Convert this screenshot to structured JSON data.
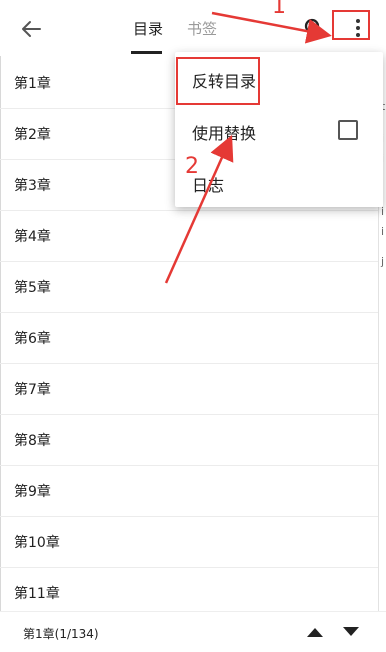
{
  "header": {
    "tabs": [
      "目录",
      "书签"
    ]
  },
  "chapters": [
    "第1章",
    "第2章",
    "第3章",
    "第4章",
    "第5章",
    "第6章",
    "第7章",
    "第8章",
    "第9章",
    "第10章",
    "第11章"
  ],
  "menu": {
    "items": [
      "反转目录",
      "使用替换",
      "日志"
    ],
    "use_replace_checked": false
  },
  "bottom_bar": {
    "current_chapter": "第1章(1/134)"
  },
  "annotations": {
    "step1": "1",
    "step2": "2"
  },
  "right_edge_glyphs": [
    "t",
    "i",
    "i",
    "i",
    "i",
    "j"
  ],
  "colors": {
    "annotation_red": "#e53935",
    "text": "#222222",
    "inactive_tab": "#9a9a9a"
  }
}
